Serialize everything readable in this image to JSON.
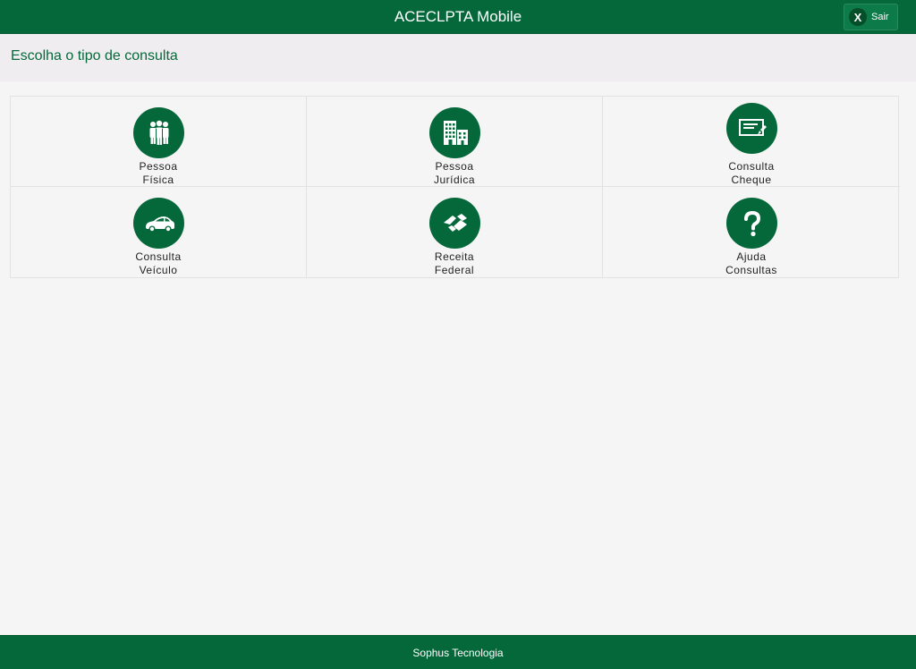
{
  "header": {
    "title": "ACECLPTA Mobile",
    "exit_button": {
      "icon_glyph": "X",
      "label": "Sair"
    }
  },
  "subheader": {
    "title": "Escolha o tipo de consulta"
  },
  "menu": {
    "items": [
      {
        "icon": "people-icon",
        "line1": "Pessoa",
        "line2": "Física"
      },
      {
        "icon": "building-icon",
        "line1": "Pessoa",
        "line2": "Jurídica"
      },
      {
        "icon": "check-icon",
        "line1": "Consulta",
        "line2": "Cheque"
      },
      {
        "icon": "car-icon",
        "line1": "Consulta",
        "line2": "Veículo"
      },
      {
        "icon": "receita-federal-icon",
        "line1": "Receita",
        "line2": "Federal"
      },
      {
        "icon": "help-icon",
        "line1": "Ajuda",
        "line2": "Consultas"
      }
    ]
  },
  "footer": {
    "text": "Sophus Tecnologia"
  },
  "colors": {
    "brand_green": "#05683a",
    "background": "#f6f5f6",
    "subheader_bg": "#efedef"
  }
}
